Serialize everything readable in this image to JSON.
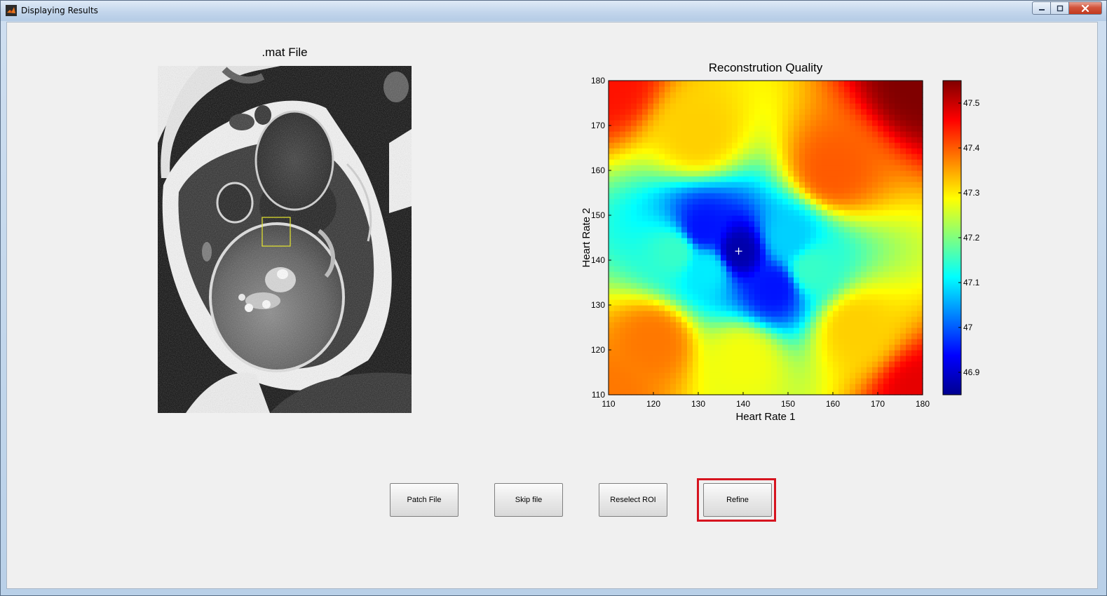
{
  "window": {
    "title": "Displaying Results",
    "icon": "matlab-icon",
    "controls": [
      "minimize-icon",
      "maximize-icon",
      "close-icon"
    ]
  },
  "left_panel": {
    "title": ".mat File",
    "image": "mri-scan-image",
    "roi_color": "#e6e62e"
  },
  "chart_data": {
    "type": "heatmap",
    "title": "Reconstrution Quality",
    "xlabel": "Heart Rate 1",
    "ylabel": "Heart Rate 2",
    "xlim": [
      110,
      180
    ],
    "ylim": [
      110,
      180
    ],
    "x_ticks": [
      "110",
      "120",
      "130",
      "140",
      "150",
      "160",
      "170",
      "180"
    ],
    "y_ticks": [
      "110",
      "120",
      "130",
      "140",
      "150",
      "160",
      "170",
      "180"
    ],
    "colorbar": {
      "min": 46.85,
      "max": 47.55,
      "ticks": [
        "46.9",
        "47",
        "47.1",
        "47.2",
        "47.3",
        "47.4",
        "47.5"
      ],
      "colormap": "jet"
    },
    "marker": {
      "x": 139,
      "y": 142,
      "symbol": "+"
    },
    "surface_anchors": [
      {
        "x": 139,
        "y": 142,
        "value": 46.88
      },
      {
        "x": 131,
        "y": 147,
        "value": 46.95
      },
      {
        "x": 147,
        "y": 134,
        "value": 46.95
      },
      {
        "x": 132,
        "y": 138,
        "value": 47.1
      },
      {
        "x": 150,
        "y": 145,
        "value": 47.08
      },
      {
        "x": 125,
        "y": 142,
        "value": 47.15
      },
      {
        "x": 155,
        "y": 138,
        "value": 47.15
      },
      {
        "x": 130,
        "y": 168,
        "value": 47.32
      },
      {
        "x": 120,
        "y": 122,
        "value": 47.38
      },
      {
        "x": 110,
        "y": 110,
        "value": 47.38
      },
      {
        "x": 110,
        "y": 180,
        "value": 47.45
      },
      {
        "x": 180,
        "y": 110,
        "value": 47.48
      },
      {
        "x": 180,
        "y": 180,
        "value": 47.55
      },
      {
        "x": 160,
        "y": 160,
        "value": 47.4
      },
      {
        "x": 165,
        "y": 125,
        "value": 47.32
      },
      {
        "x": 140,
        "y": 118,
        "value": 47.28
      }
    ]
  },
  "buttons": {
    "patch_file": "Patch File",
    "skip_file": "Skip file",
    "reselect_roi": "Reselect ROI",
    "refine": "Refine"
  },
  "highlight_color": "#d6141f"
}
